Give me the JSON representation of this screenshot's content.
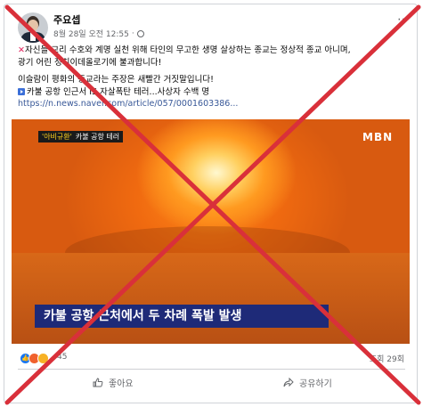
{
  "post": {
    "author": "주요셉",
    "date": "8월 28일 오전 12:55",
    "separator": "·",
    "lines": [
      "자신들 교리 수호와 계명 실천 위해 타인의 무고한 생명 살상하는 종교는 정상적 종교 아니며,",
      "광기 어린 정치이데올로기에 불과합니다!",
      "이슬람이 평화의 종교라는 주장은 새빨간 거짓말입니다!",
      "카불 공항 인근서 IS 자살폭탄 테러...사상자 수백 명"
    ],
    "link": "https://n.news.naver.com/article/057/0001603386..."
  },
  "video": {
    "badge_left": "'아비규환'",
    "badge_right": "카불 공항 테러",
    "logo": "MBN",
    "caption": "카불 공항 근처에서 두 차례 폭발 발생"
  },
  "stats": {
    "reaction_count": "45",
    "views": "조회 29회"
  },
  "actions": {
    "like": "좋아요",
    "share": "공유하기"
  },
  "colors": {
    "cross": "#d9303a",
    "caption_bg": "#1e2a78",
    "link": "#385898"
  }
}
